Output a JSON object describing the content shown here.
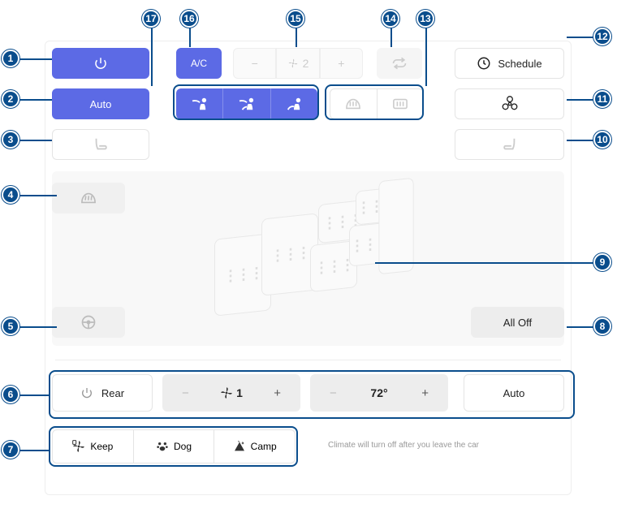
{
  "top": {
    "ac_label": "A/C",
    "fan_level": "2",
    "schedule_label": "Schedule"
  },
  "row2": {
    "auto_label": "Auto"
  },
  "seatarea": {
    "alloff_label": "All Off"
  },
  "rear": {
    "label": "Rear",
    "fan_level": "1",
    "temp": "72°",
    "auto_label": "Auto"
  },
  "modes": {
    "keep_label": "Keep",
    "dog_label": "Dog",
    "camp_label": "Camp",
    "note": "Climate will turn off after you leave the car"
  },
  "callouts": {
    "1": "1",
    "2": "2",
    "3": "3",
    "4": "4",
    "5": "5",
    "6": "6",
    "7": "7",
    "8": "8",
    "9": "9",
    "10": "10",
    "11": "11",
    "12": "12",
    "13": "13",
    "14": "14",
    "15": "15",
    "16": "16",
    "17": "17"
  }
}
